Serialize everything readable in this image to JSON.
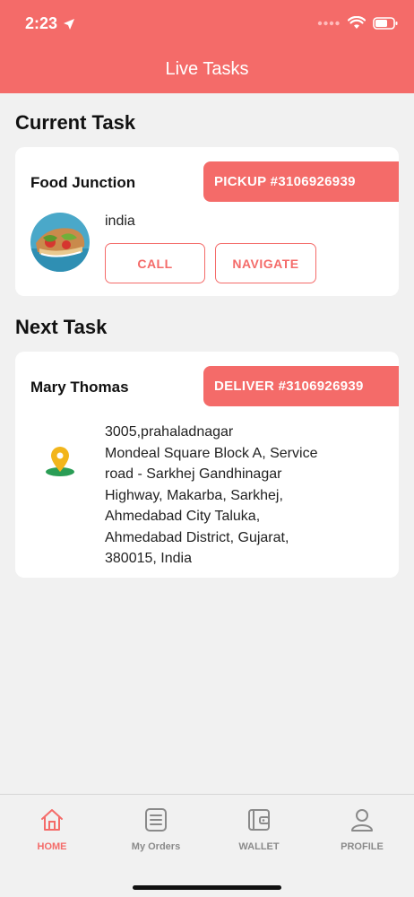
{
  "status": {
    "time": "2:23"
  },
  "header": {
    "title": "Live Tasks"
  },
  "current": {
    "section_title": "Current Task",
    "name": "Food Junction",
    "tag": "PICKUP #3106926939",
    "location": "india",
    "call_label": "CALL",
    "navigate_label": "NAVIGATE"
  },
  "next": {
    "section_title": "Next Task",
    "name": "Mary Thomas",
    "tag": "DELIVER #3106926939",
    "address_lines": [
      "3005,prahaladnagar",
      "Mondeal Square Block A, Service",
      "road - Sarkhej Gandhinagar",
      "Highway, Makarba, Sarkhej,",
      "Ahmedabad City Taluka,",
      "Ahmedabad District, Gujarat,",
      "380015, India"
    ]
  },
  "tabs": [
    {
      "label": "HOME",
      "icon": "home-icon",
      "active": true
    },
    {
      "label": "My Orders",
      "icon": "orders-icon",
      "active": false
    },
    {
      "label": "WALLET",
      "icon": "wallet-icon",
      "active": false
    },
    {
      "label": "PROFILE",
      "icon": "profile-icon",
      "active": false
    }
  ],
  "colors": {
    "accent": "#f46b69",
    "background": "#f1f1f1",
    "inactive": "#8a8a8a"
  }
}
